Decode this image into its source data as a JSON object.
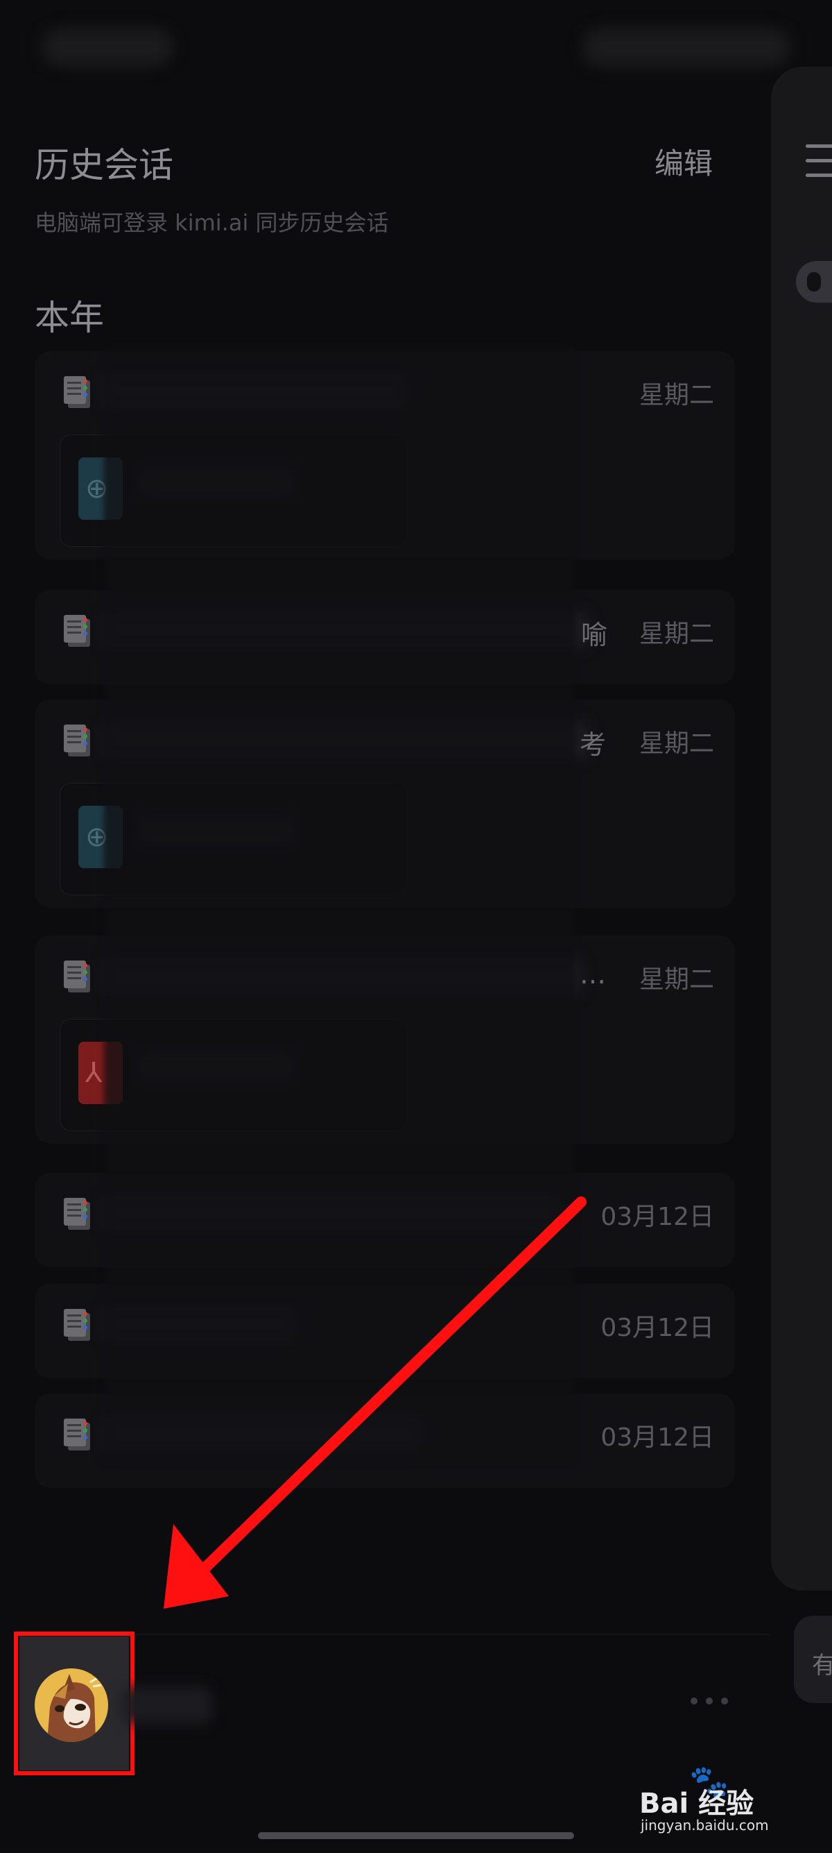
{
  "header": {
    "title": "历史会话",
    "edit_label": "编辑",
    "subtitle": "电脑端可登录 kimi.ai  同步历史会话"
  },
  "section": {
    "title": "本年"
  },
  "conversations": [
    {
      "date": "星期二",
      "trailing_char": "",
      "attachment": "globe-icon"
    },
    {
      "date": "星期二",
      "trailing_char": "喻",
      "attachment": ""
    },
    {
      "date": "星期二",
      "trailing_char": "考",
      "attachment": "globe-icon"
    },
    {
      "date": "星期二",
      "trailing_char": "…",
      "attachment": "pdf-icon"
    },
    {
      "date": "03月12日",
      "trailing_char": "",
      "attachment": ""
    },
    {
      "date": "03月12日",
      "trailing_char": "",
      "attachment": ""
    },
    {
      "date": "03月12日",
      "trailing_char": "",
      "attachment": ""
    }
  ],
  "main_panel": {
    "input_hint": "有"
  },
  "footer": {
    "more_label": "•••"
  },
  "watermark": {
    "brand": "Bai  经验",
    "url": "jingyan.baidu.com"
  },
  "colors": {
    "background": "#0c0c0e",
    "highlight": "#ff1010",
    "avatar_bg": "#e9b94c"
  }
}
